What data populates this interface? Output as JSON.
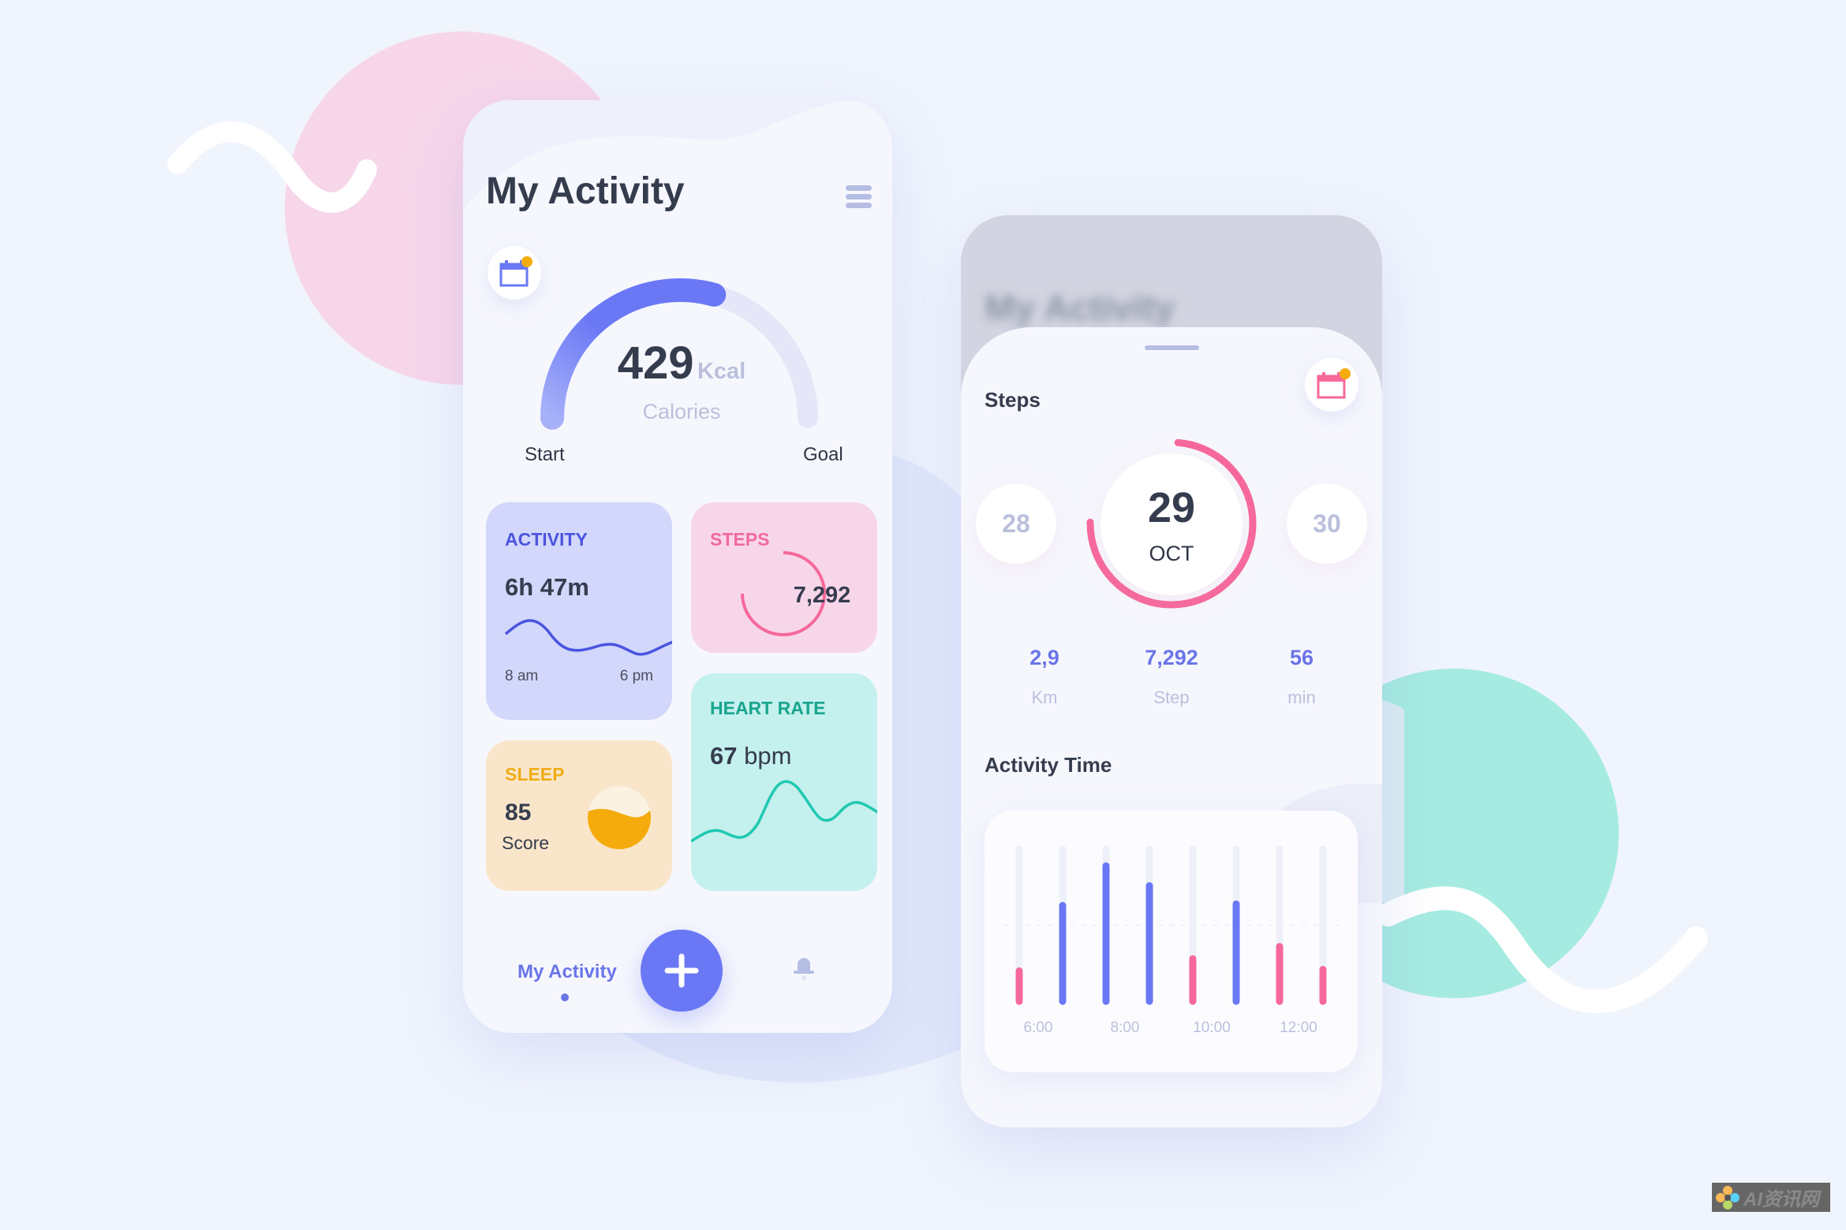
{
  "colors": {
    "accent": "#6a78f6",
    "pink": "#f6689a",
    "teal": "#1fc8b0",
    "amber": "#f5ab0c",
    "dark": "#353c4e",
    "muted": "#bac0dc"
  },
  "left_phone": {
    "title": "My Activity",
    "menu_icon": "hamburger-icon",
    "calendar_icon": "calendar-icon",
    "calories": {
      "value": "429",
      "unit": "Kcal",
      "label": "Calories",
      "progress": 0.586,
      "start_label": "Start",
      "goal_label": "Goal"
    },
    "cards": {
      "activity": {
        "title": "ACTIVITY",
        "value": "6h 47m",
        "from": "8 am",
        "to": "6 pm"
      },
      "steps": {
        "title": "STEPS",
        "value": "7,292",
        "progress": 0.75
      },
      "sleep": {
        "title": "SLEEP",
        "value": "85",
        "label": "Score"
      },
      "heart": {
        "title": "HEART RATE",
        "value": "67",
        "unit": "bpm"
      }
    },
    "nav": {
      "active_label": "My Activity",
      "add_icon": "plus-icon",
      "bell_icon": "bell-icon"
    }
  },
  "right_phone": {
    "blurred_title": "My Activity",
    "section_title": "Steps",
    "calendar_icon": "calendar-icon",
    "days": {
      "prev": "28",
      "current": "29",
      "month": "OCT",
      "next": "30",
      "progress": 0.74
    },
    "stats": [
      {
        "value": "2,9",
        "label": "Km"
      },
      {
        "value": "7,292",
        "label": "Step"
      },
      {
        "value": "56",
        "label": "min"
      }
    ],
    "activity_title": "Activity Time"
  },
  "chart_data": {
    "type": "bar",
    "title": "Activity Time",
    "values": [
      20,
      63,
      89,
      76,
      28,
      64,
      36,
      21
    ],
    "bar_colors": [
      "#f6689a",
      "#6a78f6",
      "#6a78f6",
      "#6a78f6",
      "#f6689a",
      "#6a78f6",
      "#f6689a",
      "#f6689a"
    ],
    "reference_line": 50,
    "tick_labels": [
      "6:00",
      "8:00",
      "10:00",
      "12:00"
    ],
    "ylim": [
      0,
      100
    ],
    "grid": false
  },
  "watermark": {
    "text": "AI资讯网"
  }
}
